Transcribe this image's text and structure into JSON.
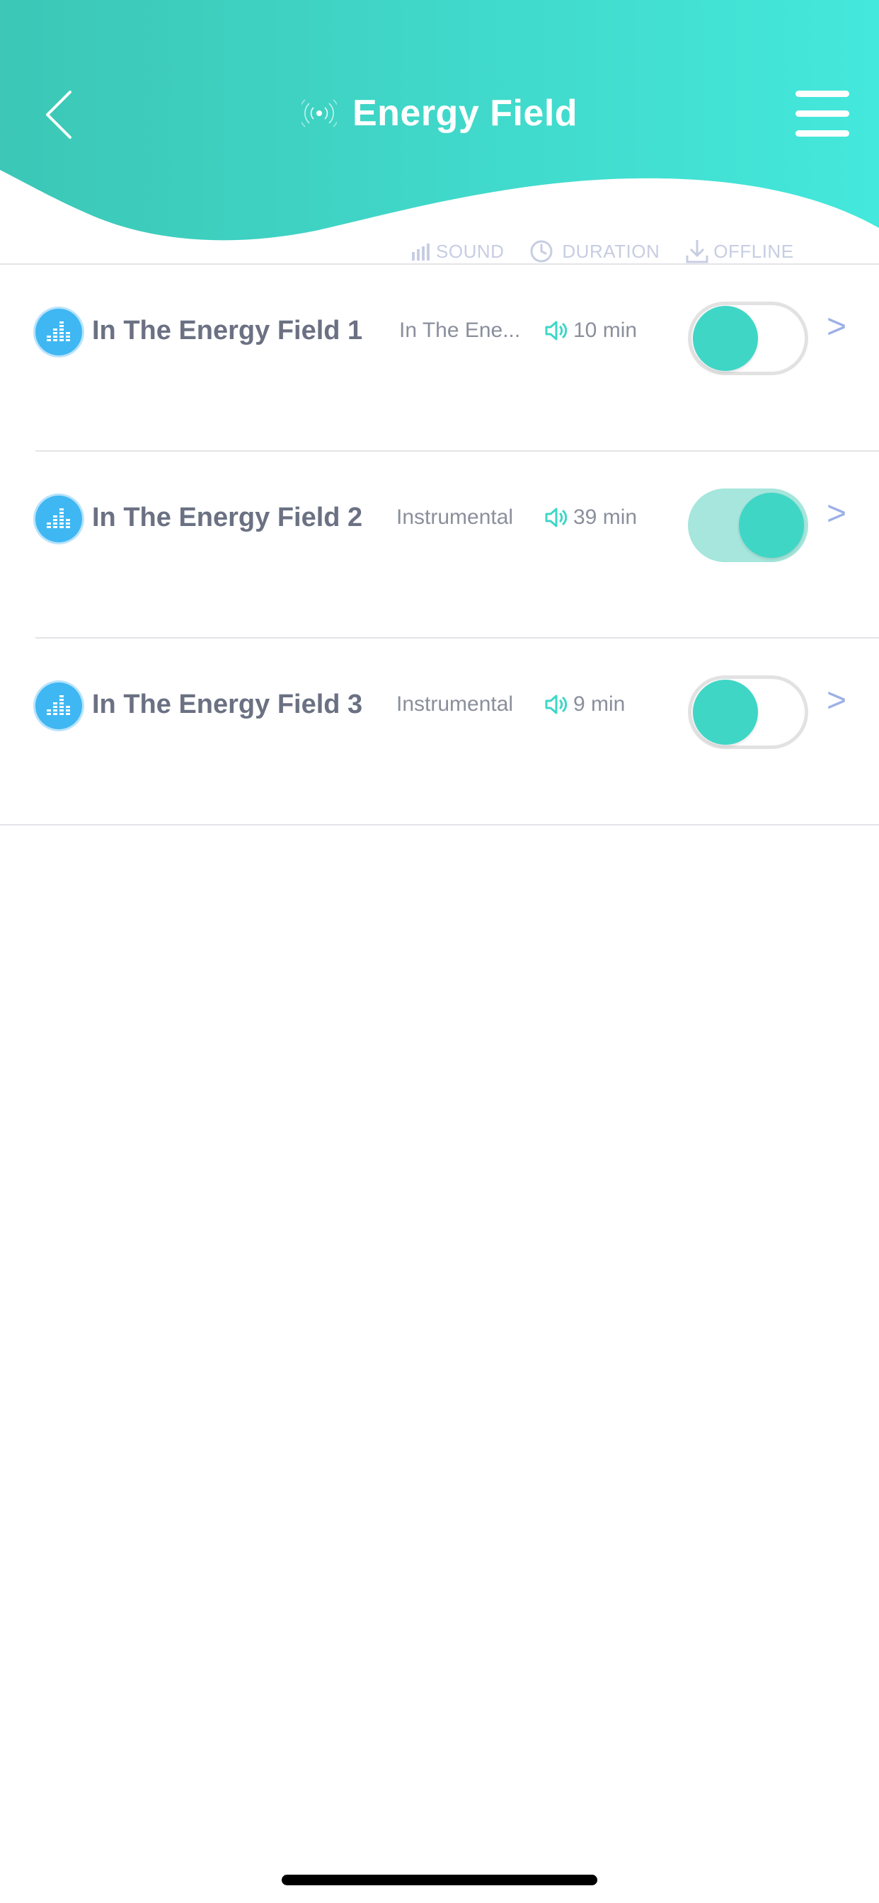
{
  "header": {
    "title": "Energy Field",
    "back_icon": "chevron-left-icon",
    "title_icon": "broadcast-icon",
    "menu_icon": "hamburger-menu-icon",
    "gradient_start": "#3cc7b6",
    "gradient_end": "#44e8dc"
  },
  "columns": {
    "sound": "SOUND",
    "duration": "DURATION",
    "offline": "OFFLINE"
  },
  "tracks": [
    {
      "name": "In The Energy Field 1",
      "genre": "In The Ene...",
      "duration": "10 min",
      "enabled": false
    },
    {
      "name": "In The Energy Field 2",
      "genre": "Instrumental",
      "duration": "39 min",
      "enabled": true
    },
    {
      "name": "In The Energy Field 3",
      "genre": "Instrumental",
      "duration": "9 min",
      "enabled": false
    }
  ],
  "colors": {
    "accent": "#3fd6c6",
    "badge": "#3fb7f3",
    "chevron": "#9cb0e6"
  }
}
